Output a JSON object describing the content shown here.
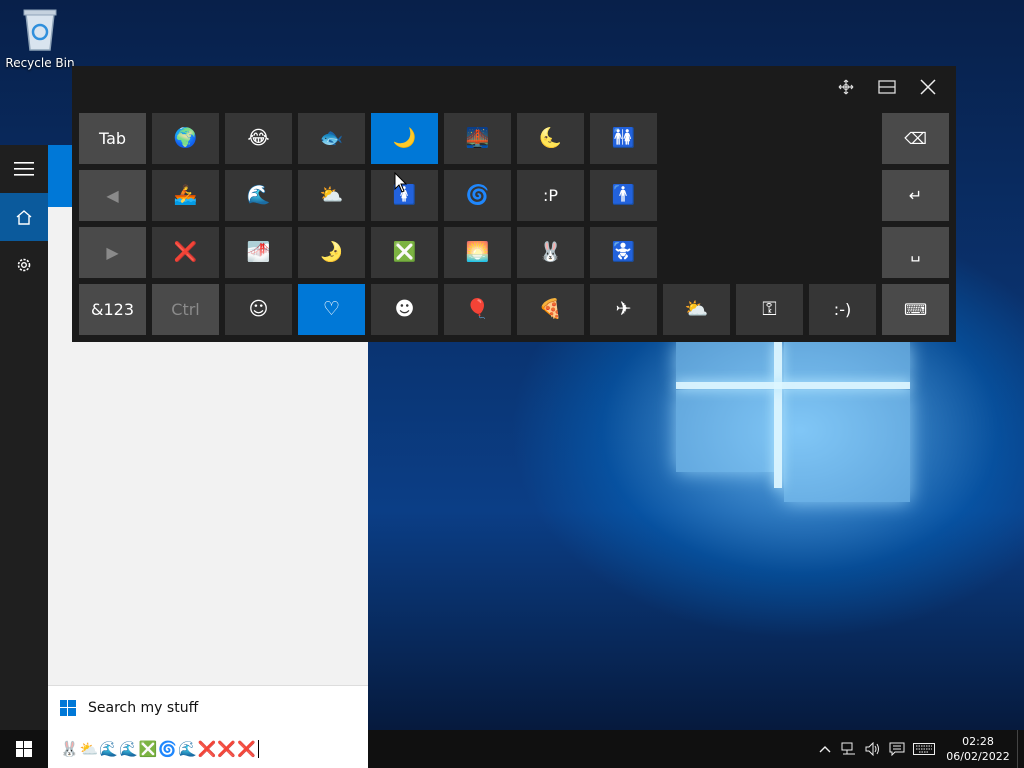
{
  "desktop": {
    "recycle_bin_label": "Recycle Bin"
  },
  "start_menu": {
    "search_label": "Search my stuff",
    "search_value": "🐰⛅🌊🌊❎🌀🌊❌❌❌"
  },
  "keyboard": {
    "rows": [
      [
        {
          "label": "Tab",
          "name": "tab-key",
          "dark": true
        },
        {
          "label": "🌍",
          "name": "emoji-earth-globe"
        },
        {
          "label": "😂",
          "name": "emoji-face-tears-of-joy"
        },
        {
          "label": "🐟",
          "name": "emoji-fish"
        },
        {
          "label": "🌙",
          "name": "emoji-crescent-moon",
          "selected": true
        },
        {
          "label": "🌉",
          "name": "emoji-bridge-at-night"
        },
        {
          "label": "🌜",
          "name": "emoji-last-quarter-moon-face"
        },
        {
          "label": "🚻",
          "name": "emoji-restroom"
        }
      ],
      [
        {
          "label": "◀",
          "name": "prev-page-key",
          "dark": true,
          "muted": true
        },
        {
          "label": "🚣",
          "name": "emoji-rowboat"
        },
        {
          "label": "🌊",
          "name": "emoji-water-wave"
        },
        {
          "label": "⛅",
          "name": "emoji-sun-behind-cloud"
        },
        {
          "label": "🚺",
          "name": "emoji-womens"
        },
        {
          "label": "🌀",
          "name": "emoji-cyclone"
        },
        {
          "label": ":P",
          "name": "emoji-tongue-text"
        },
        {
          "label": "🚹",
          "name": "emoji-mens"
        }
      ],
      [
        {
          "label": "▶",
          "name": "next-page-key",
          "dark": true,
          "muted": true
        },
        {
          "label": "❌",
          "name": "emoji-cross-mark"
        },
        {
          "label": "🌁",
          "name": "emoji-foggy"
        },
        {
          "label": "🌛",
          "name": "emoji-first-quarter-moon-face"
        },
        {
          "label": "❎",
          "name": "emoji-cross-mark-button"
        },
        {
          "label": "🌅",
          "name": "emoji-sunrise"
        },
        {
          "label": "🐰",
          "name": "emoji-rabbit-face"
        },
        {
          "label": "🚼",
          "name": "emoji-baby-symbol"
        }
      ]
    ],
    "bottom_row": [
      {
        "label": "&123",
        "name": "numbers-key",
        "dark": true
      },
      {
        "label": "Ctrl",
        "name": "ctrl-key",
        "dark": true,
        "muted": true
      },
      {
        "label": "☺",
        "name": "category-smiley-icon"
      },
      {
        "label": "♡",
        "name": "category-heart-icon",
        "selected": true
      },
      {
        "label": "☻",
        "name": "category-people-icon"
      },
      {
        "label": "🎈",
        "name": "category-celebration-icon"
      },
      {
        "label": "🍕",
        "name": "category-food-icon"
      },
      {
        "label": "✈",
        "name": "category-travel-icon"
      },
      {
        "label": "⛅",
        "name": "category-weather-icon"
      },
      {
        "label": "⚿",
        "name": "category-symbols-icon"
      },
      {
        "label": ":-)",
        "name": "category-text-faces-icon"
      },
      {
        "label": "⌨",
        "name": "keyboard-switch-icon",
        "dark": true
      }
    ],
    "right_column": [
      {
        "label": "⌫",
        "name": "backspace-key"
      },
      {
        "label": "↵",
        "name": "enter-key"
      },
      {
        "label": "␣",
        "name": "space-key"
      }
    ]
  },
  "taskbar": {
    "time": "02:28",
    "date": "06/02/2022"
  }
}
